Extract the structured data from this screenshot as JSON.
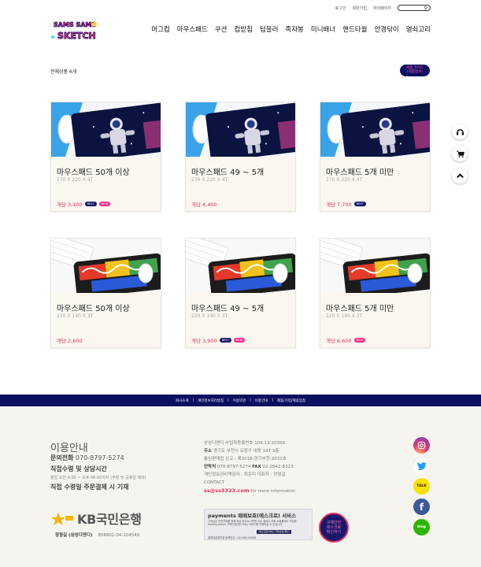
{
  "topbar": {
    "login": "로그인",
    "join": "회원가입",
    "mypage": "마이페이지",
    "search_placeholder": ""
  },
  "logo": {
    "line1": "SAMS SAMS",
    "line2": "SKETCH"
  },
  "nav": [
    "머그컵",
    "마우스패드",
    "쿠션",
    "컵받침",
    "텀블러",
    "족자봉",
    "미니배너",
    "핸드타월",
    "안경닦이",
    "열쇠고리"
  ],
  "product_count": "전체상품 6개",
  "guide_button": "제품 가이드\n(제품정보)",
  "products": [
    {
      "name": "마우스패드 50개 이상",
      "size": "270 X 220 X 4T",
      "price": "개당 3,100",
      "tags": [
        "BEST",
        "NEW"
      ],
      "theme": "space"
    },
    {
      "name": "마우스패드 49 ~ 5개",
      "size": "270 X 220 X 4T",
      "price": "개당 4,400",
      "tags": [],
      "theme": "space"
    },
    {
      "name": "마우스패드 5개 미만",
      "size": "270 X 220 X 4T",
      "price": "개당 7,700",
      "tags": [
        "BEST"
      ],
      "theme": "space"
    },
    {
      "name": "마우스패드 50개 이상",
      "size": "220 X 190 X 3T",
      "price": "개당 2,600",
      "tags": [],
      "theme": "graffiti"
    },
    {
      "name": "마우스패드 49 ~ 5개",
      "size": "220 X 190 X 3T",
      "price": "개당 3,900",
      "tags": [
        "BEST",
        "NEW"
      ],
      "theme": "graffiti"
    },
    {
      "name": "마우스패드 5개 미만",
      "size": "220 X 190 X 3T",
      "price": "개당 6,600",
      "tags": [
        "NEW"
      ],
      "theme": "graffiti"
    }
  ],
  "side_icons": [
    "headset-icon",
    "cart-icon",
    "chevron-up-icon"
  ],
  "footer_links": [
    "회사소개",
    "|",
    "개인정보처리방침",
    "|",
    "이용약관",
    "|",
    "이용안내",
    "|",
    "제휴/기업/제휴입점"
  ],
  "usage": {
    "title": "이용안내",
    "phone_label": "문의전화",
    "phone": "070-8797-5274",
    "pickup_title": "직접수령 및 상담시간",
    "hours": "평일 오전 9:00 ~ 오후 06:00까지 (주말 및 공휴일 제외)",
    "pickup_note": "직접 수령일 주문결제 시 기재"
  },
  "bank": {
    "name": "KB국민은행",
    "holder": "장형길 (삼성디엔디)",
    "account": "808801-04-104549"
  },
  "company": {
    "line1": "상상디엔디  사업자등록번호 109-13-20356",
    "line2_label": "주소",
    "line2": "경기도 부천시 오정구 내동 197 3층",
    "line3": "통신판매업 신고 : 제2018-경기부천-2031호",
    "line4_label": "연락처",
    "line4": "070-8797-5274",
    "fax_label": "FAX",
    "fax": "02-2642-8323",
    "line5": "개인정보관리책임자 : 최은미  대표자 : 장형길",
    "contact": "CONTACT",
    "email": "ss@ss3323.com",
    "email_suffix": "for more information"
  },
  "payments": {
    "title": "payments 매매보호(에스크로) 서비스",
    "desc": "고객님은 안전거래를 위해 현금 등으로 5만원 이상 결제시 저희 쇼핑몰에서 가입한 TossPayments 구매안전(에스크로) 서비스를 이용하실 수 있습니다.",
    "button": "에스크로서비스 가입사실 확인",
    "reg": "결제대금예치업 등록번호 : 02-006-00008"
  },
  "escrow_badge": "구매안전\n에스크로\n확인하기",
  "social": [
    "instagram-icon",
    "twitter-icon",
    "kakaotalk-icon",
    "facebook-icon",
    "blog-icon"
  ],
  "colors": {
    "navy": "#0c1060",
    "pink": "#e0305f",
    "footer_bg": "#f6f4ef",
    "card_bg": "#faf6f0"
  }
}
